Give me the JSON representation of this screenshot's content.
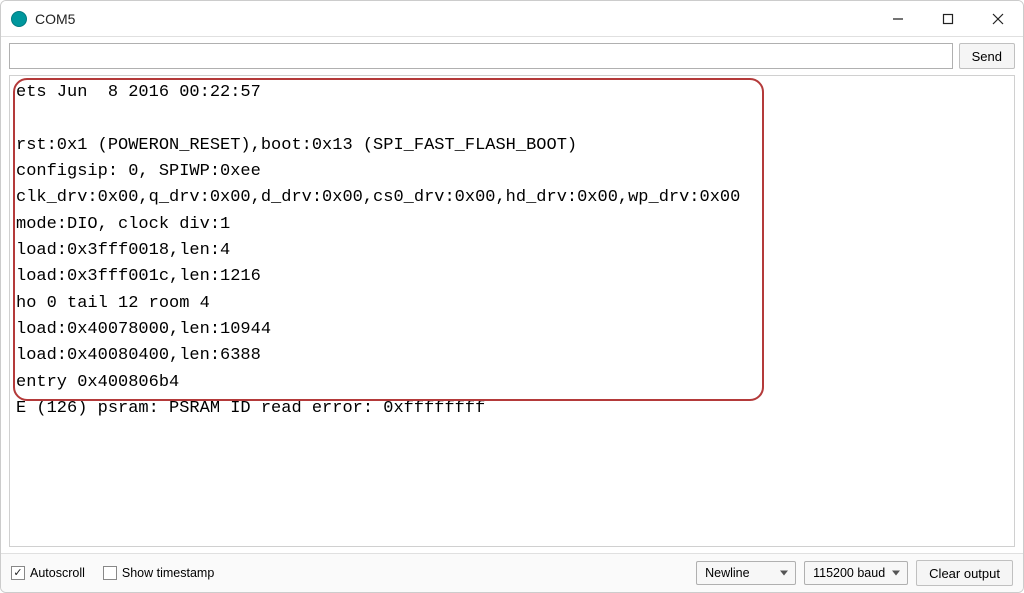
{
  "window": {
    "title": "COM5"
  },
  "sendbar": {
    "input_value": "",
    "send_label": "Send"
  },
  "output": {
    "lines": [
      "ets Jun  8 2016 00:22:57",
      "",
      "rst:0x1 (POWERON_RESET),boot:0x13 (SPI_FAST_FLASH_BOOT)",
      "configsip: 0, SPIWP:0xee",
      "clk_drv:0x00,q_drv:0x00,d_drv:0x00,cs0_drv:0x00,hd_drv:0x00,wp_drv:0x00",
      "mode:DIO, clock div:1",
      "load:0x3fff0018,len:4",
      "load:0x3fff001c,len:1216",
      "ho 0 tail 12 room 4",
      "load:0x40078000,len:10944",
      "load:0x40080400,len:6388",
      "entry 0x400806b4",
      "E (126) psram: PSRAM ID read error: 0xffffffff"
    ]
  },
  "footer": {
    "autoscroll_label": "Autoscroll",
    "timestamp_label": "Show timestamp",
    "autoscroll_checked": true,
    "timestamp_checked": false,
    "line_ending": "Newline",
    "baud": "115200 baud",
    "clear_label": "Clear output"
  }
}
